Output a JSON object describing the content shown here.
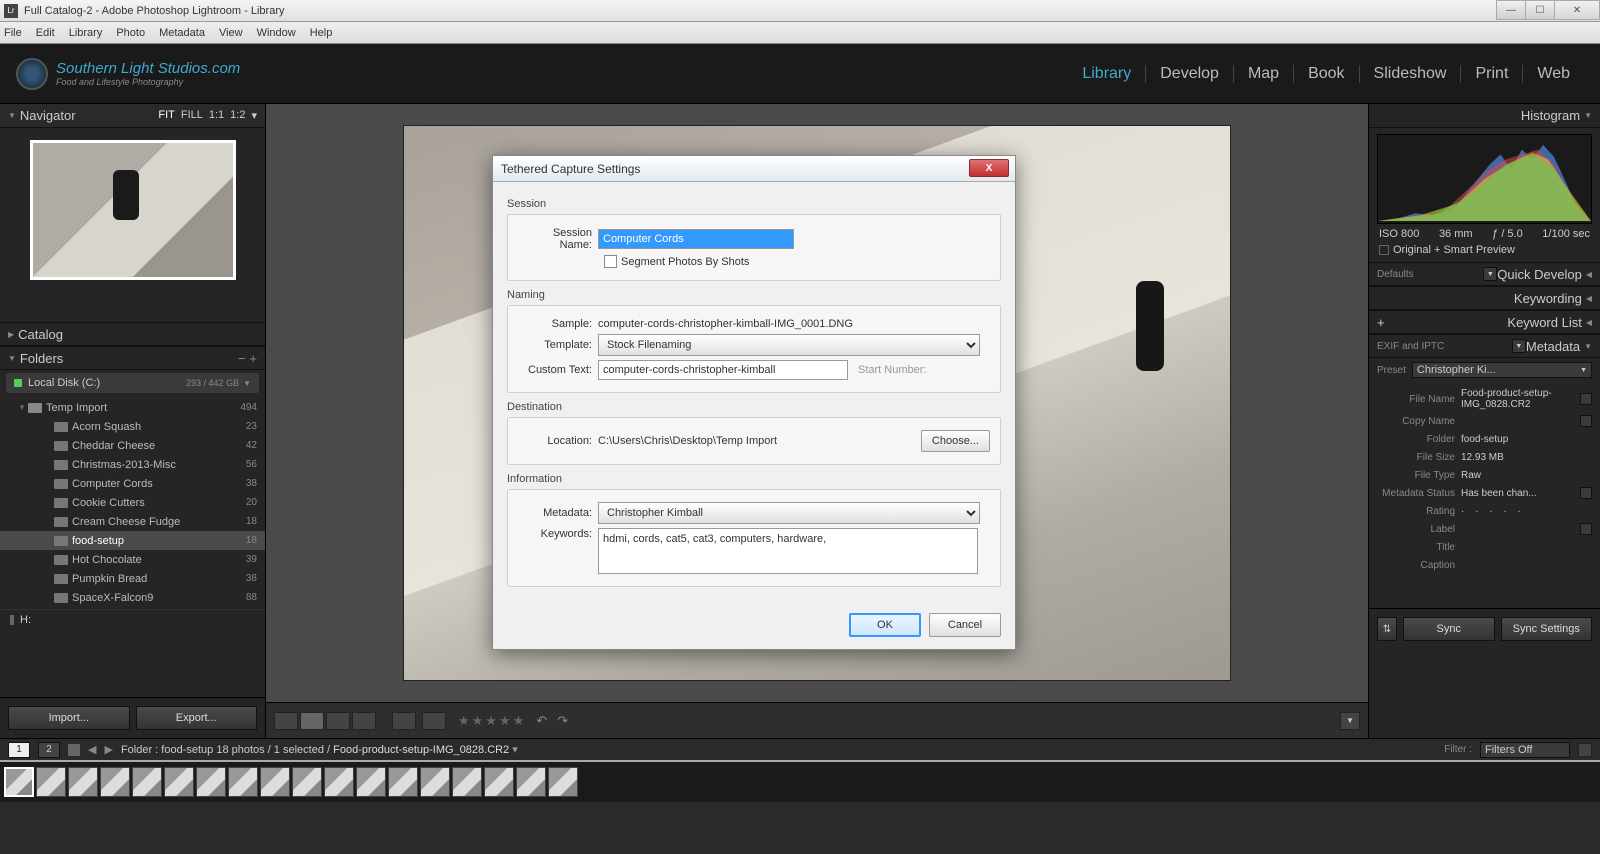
{
  "window": {
    "title": "Full Catalog-2 - Adobe Photoshop Lightroom - Library"
  },
  "menu": [
    "File",
    "Edit",
    "Library",
    "Photo",
    "Metadata",
    "View",
    "Window",
    "Help"
  ],
  "logo": {
    "line1": "Southern Light Studios.com",
    "line2": "Food and Lifestyle Photography"
  },
  "modules": [
    "Library",
    "Develop",
    "Map",
    "Book",
    "Slideshow",
    "Print",
    "Web"
  ],
  "modules_active": "Library",
  "navigator": {
    "title": "Navigator",
    "opts": [
      "FIT",
      "FILL",
      "1:1",
      "1:2"
    ],
    "arrow": "▾"
  },
  "catalog": {
    "title": "Catalog"
  },
  "folders": {
    "title": "Folders",
    "disk": {
      "name": "Local Disk (C:)",
      "size": "293 / 442 GB"
    },
    "root": {
      "name": "Temp Import",
      "count": "494"
    },
    "items": [
      {
        "name": "Acorn Squash",
        "count": "23"
      },
      {
        "name": "Cheddar Cheese",
        "count": "42"
      },
      {
        "name": "Christmas-2013-Misc",
        "count": "56"
      },
      {
        "name": "Computer Cords",
        "count": "38"
      },
      {
        "name": "Cookie Cutters",
        "count": "20"
      },
      {
        "name": "Cream Cheese Fudge",
        "count": "18"
      },
      {
        "name": "food-setup",
        "count": "18",
        "selected": true
      },
      {
        "name": "Hot Chocolate",
        "count": "39"
      },
      {
        "name": "Pumpkin Bread",
        "count": "38"
      },
      {
        "name": "SpaceX-Falcon9",
        "count": "88"
      }
    ],
    "drive_h": "H:"
  },
  "left_buttons": {
    "import": "Import...",
    "export": "Export..."
  },
  "histogram": {
    "title": "Histogram",
    "iso": "ISO 800",
    "focal": "36 mm",
    "aperture": "ƒ / 5.0",
    "shutter": "1/100 sec",
    "sub": "Original + Smart Preview"
  },
  "quick_develop": {
    "defaults": "Defaults",
    "title": "Quick Develop"
  },
  "keywording": {
    "title": "Keywording"
  },
  "keyword_list": {
    "title": "Keyword List"
  },
  "metadata": {
    "mode": "EXIF and IPTC",
    "title": "Metadata",
    "preset_label": "Preset",
    "preset": "Christopher Ki...",
    "rows": [
      {
        "k": "File Name",
        "v": "Food-product-setup-IMG_0828.CR2",
        "ic": true
      },
      {
        "k": "Copy Name",
        "v": "",
        "ic": true
      },
      {
        "k": "Folder",
        "v": "food-setup"
      },
      {
        "k": "File Size",
        "v": "12.93 MB"
      },
      {
        "k": "File Type",
        "v": "Raw"
      },
      {
        "k": "Metadata Status",
        "v": "Has been chan...",
        "ic": true
      },
      {
        "k": "Rating",
        "v": "· · · · ·",
        "rating": true
      },
      {
        "k": "Label",
        "v": "",
        "ic": true
      },
      {
        "k": "Title",
        "v": ""
      },
      {
        "k": "Caption",
        "v": ""
      }
    ]
  },
  "right_buttons": {
    "sync": "Sync",
    "sync_settings": "Sync Settings"
  },
  "statusbar": {
    "nums": [
      "1",
      "2"
    ],
    "path_prefix": "Folder : food-setup      18 photos / 1 selected /",
    "path_file": "Food-product-setup-IMG_0828.CR2",
    "filter_label": "Filter :",
    "filter_value": "Filters Off"
  },
  "dialog": {
    "title": "Tethered Capture Settings",
    "sections": {
      "session": "Session",
      "naming": "Naming",
      "destination": "Destination",
      "information": "Information"
    },
    "session_name_label": "Session Name:",
    "session_name": "Computer Cords",
    "segment_label": "Segment Photos By Shots",
    "sample_label": "Sample:",
    "sample": "computer-cords-christopher-kimball-IMG_0001.DNG",
    "template_label": "Template:",
    "template": "Stock Filenaming",
    "custom_label": "Custom Text:",
    "custom": "computer-cords-christopher-kimball",
    "start_label": "Start Number:",
    "location_label": "Location:",
    "location": "C:\\Users\\Chris\\Desktop\\Temp Import",
    "choose": "Choose...",
    "metadata_label": "Metadata:",
    "metadata": "Christopher Kimball",
    "keywords_label": "Keywords:",
    "keywords": "hdmi, cords, cat5, cat3, computers, hardware,",
    "ok": "OK",
    "cancel": "Cancel"
  }
}
